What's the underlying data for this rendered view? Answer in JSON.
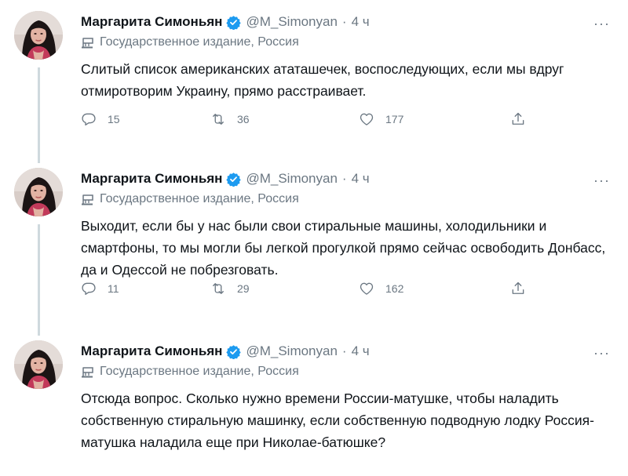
{
  "tweets": [
    {
      "display_name": "Маргарита Симоньян",
      "handle": "@M_Simonyan",
      "dot": "·",
      "time": "4 ч",
      "label": "Государственное издание, Россия",
      "text": "Слитый список американских ататашечек, воспоследующих, если мы вдруг отмиротворим Украину, прямо расстраивает.",
      "replies": "15",
      "retweets": "36",
      "likes": "177"
    },
    {
      "display_name": "Маргарита Симоньян",
      "handle": "@M_Simonyan",
      "dot": "·",
      "time": "4 ч",
      "label": "Государственное издание, Россия",
      "text": "Выходит, если бы у нас были свои стиральные машины, холодильники и смартфоны, то мы могли бы легкой прогулкой прямо сейчас освободить Донбасс, да и Одессой не побрезговать.",
      "replies": "11",
      "retweets": "29",
      "likes": "162"
    },
    {
      "display_name": "Маргарита Симоньян",
      "handle": "@M_Simonyan",
      "dot": "·",
      "time": "4 ч",
      "label": "Государственное издание, Россия",
      "text": "Отсюда вопрос. Сколько нужно времени России-матушке, чтобы наладить собственную стиральную машинку, если собственную подводную лодку Россия-матушка наладила еще при Николае-батюшке?"
    }
  ],
  "more_glyph": "···",
  "colors": {
    "verified": "#1d9bf0",
    "secondary_text": "#6b7782",
    "thread_line": "#cfd9de"
  },
  "icons": [
    "verified-badge-icon",
    "state-media-flag-icon",
    "reply-icon",
    "retweet-icon",
    "like-icon",
    "share-icon",
    "more-icon"
  ]
}
